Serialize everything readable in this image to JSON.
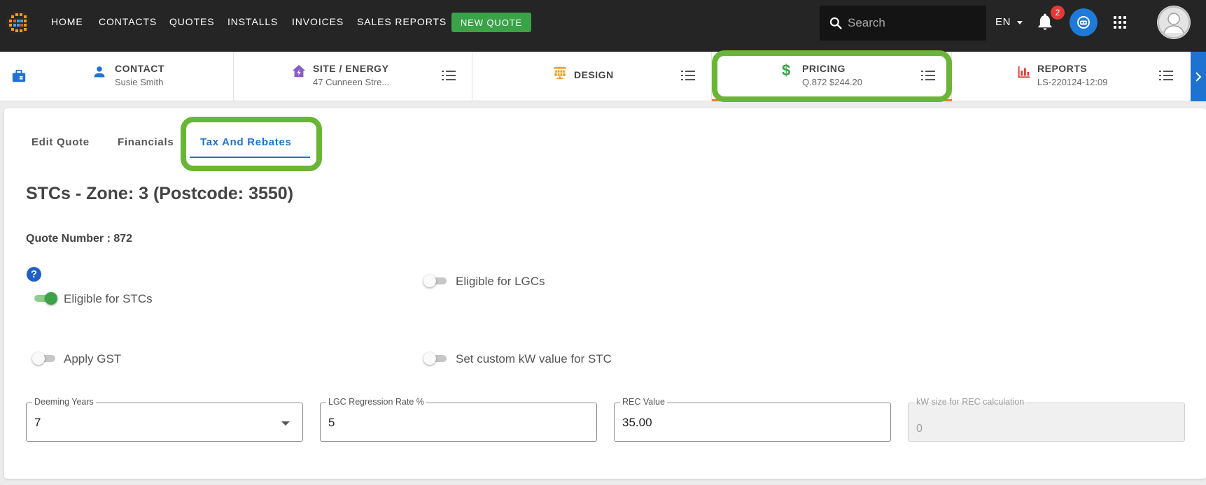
{
  "topbar": {
    "nav": [
      "HOME",
      "CONTACTS",
      "QUOTES",
      "INSTALLS",
      "INVOICES",
      "SALES REPORTS"
    ],
    "new_quote_label": "NEW QUOTE",
    "search_placeholder": "Search",
    "language": "EN",
    "notification_count": "2"
  },
  "steps": {
    "contact": {
      "title": "CONTACT",
      "subtitle": "Susie Smith"
    },
    "site": {
      "title": "SITE / ENERGY",
      "subtitle": "47 Cunneen Stre..."
    },
    "design": {
      "title": "DESIGN"
    },
    "pricing": {
      "title": "PRICING",
      "subtitle": "Q.872 $244.20"
    },
    "reports": {
      "title": "REPORTS",
      "subtitle": "LS-220124-12:09"
    }
  },
  "tabs": {
    "edit_quote": "Edit Quote",
    "financials": "Financials",
    "tax_rebates": "Tax And Rebates",
    "active": "tax_rebates"
  },
  "section_title": "STCs - Zone: 3 (Postcode: 3550)",
  "quote_number": "Quote Number : 872",
  "toggles": {
    "eligible_stcs": {
      "label": "Eligible for STCs",
      "on": true
    },
    "eligible_lgcs": {
      "label": "Eligible for LGCs",
      "on": false
    },
    "apply_gst": {
      "label": "Apply GST",
      "on": false
    },
    "custom_kw": {
      "label": "Set custom kW value for STC",
      "on": false
    }
  },
  "fields": {
    "deeming_years": {
      "label": "Deeming Years",
      "value": "7"
    },
    "lgc_regression": {
      "label": "LGC Regression Rate %",
      "value": "5"
    },
    "rec_value": {
      "label": "REC Value",
      "value": "35.00"
    },
    "kw_size": {
      "label": "kW size for REC calculation",
      "value": "0"
    }
  },
  "colors": {
    "brand_green": "#3aa347",
    "highlight_green": "#6ab536",
    "accent_blue": "#1e73d0",
    "pricing_underline": "#f07b2b",
    "topbar_bg": "#252525"
  }
}
